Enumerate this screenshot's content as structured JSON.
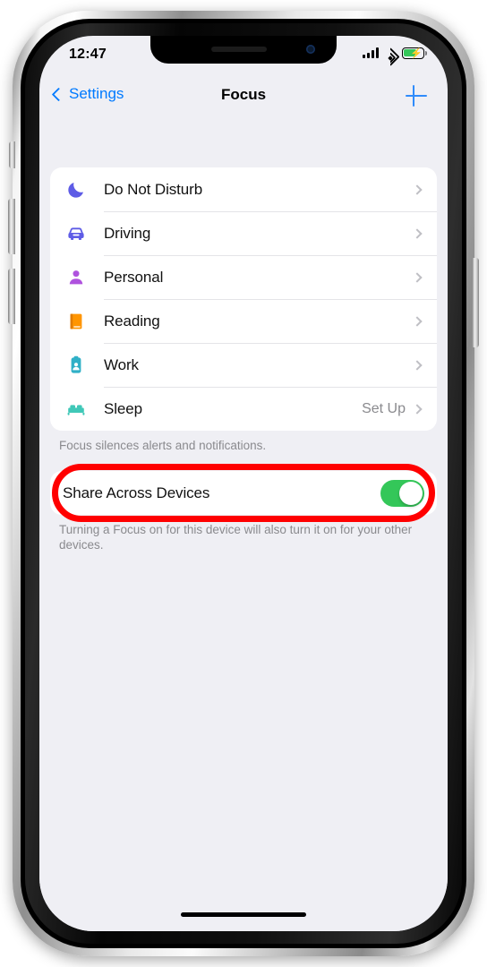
{
  "status_bar": {
    "time": "12:47",
    "signal_icon": "cellular-bars-icon",
    "wifi_icon": "wifi-icon",
    "battery_icon": "battery-charging-icon",
    "battery_level_percent": 60,
    "battery_color": "#34C759"
  },
  "nav": {
    "back_label": "Settings",
    "title": "Focus",
    "add_label": "+",
    "tint_color": "#007AFF"
  },
  "focus_list": [
    {
      "label": "Do Not Disturb",
      "icon": "moon-icon",
      "color": "#5E5CE6",
      "value": "",
      "accessory": "chevron-right-icon"
    },
    {
      "label": "Driving",
      "icon": "car-icon",
      "color": "#5E5CE6",
      "value": "",
      "accessory": "chevron-right-icon"
    },
    {
      "label": "Personal",
      "icon": "person-icon",
      "color": "#AF52DE",
      "value": "",
      "accessory": "chevron-right-icon"
    },
    {
      "label": "Reading",
      "icon": "book-icon",
      "color": "#FF9500",
      "value": "",
      "accessory": "chevron-right-icon"
    },
    {
      "label": "Work",
      "icon": "badge-icon",
      "color": "#30B0C7",
      "value": "",
      "accessory": "chevron-right-icon"
    },
    {
      "label": "Sleep",
      "icon": "bed-icon",
      "color": "#40C8B8",
      "value": "Set Up",
      "accessory": "chevron-right-icon"
    }
  ],
  "list_caption": "Focus silences alerts and notifications.",
  "share_setting": {
    "label": "Share Across Devices",
    "toggle_state": "on",
    "toggle_on_color": "#34C759",
    "caption": "Turning a Focus on for this device will also turn it on for your other devices."
  },
  "annotation": {
    "shape": "rounded-rectangle-highlight",
    "color": "#FF0000",
    "target": "Share Across Devices"
  }
}
